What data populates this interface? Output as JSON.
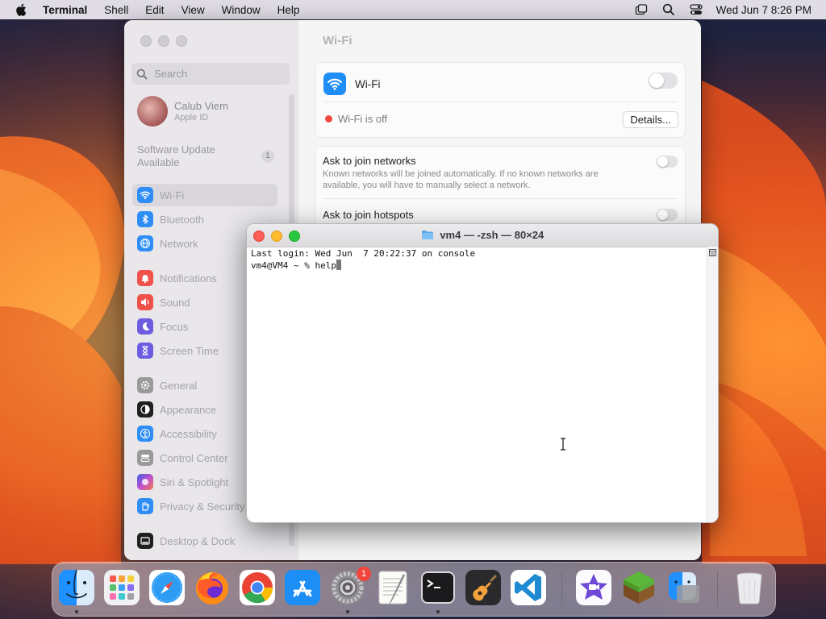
{
  "menubar": {
    "app_name": "Terminal",
    "items": [
      "Shell",
      "Edit",
      "View",
      "Window",
      "Help"
    ],
    "clock": "Wed Jun 7  8:26 PM"
  },
  "settings": {
    "search_placeholder": "Search",
    "account": {
      "name": "Calub Viem",
      "sub": "Apple ID"
    },
    "update": {
      "label_line1": "Software Update",
      "label_line2": "Available",
      "count": "1"
    },
    "sidebar_items": [
      {
        "label": "Wi-Fi",
        "icon": "wifi-icon",
        "color": "#2f8ef6"
      },
      {
        "label": "Bluetooth",
        "icon": "bluetooth-icon",
        "color": "#2f8ef6"
      },
      {
        "label": "Network",
        "icon": "globe-icon",
        "color": "#2f8ef6"
      },
      {
        "label": "Notifications",
        "icon": "bell-icon",
        "color": "#f0524b"
      },
      {
        "label": "Sound",
        "icon": "speaker-icon",
        "color": "#f0524b"
      },
      {
        "label": "Focus",
        "icon": "moon-icon",
        "color": "#6d5ce0"
      },
      {
        "label": "Screen Time",
        "icon": "hourglass-icon",
        "color": "#6d5ce0"
      },
      {
        "label": "General",
        "icon": "gear-icon",
        "color": "#9a989b"
      },
      {
        "label": "Appearance",
        "icon": "appearance-icon",
        "color": "#1f1f1f"
      },
      {
        "label": "Accessibility",
        "icon": "accessibility-icon",
        "color": "#2f8ef6"
      },
      {
        "label": "Control Center",
        "icon": "control-center-icon",
        "color": "#9a989b"
      },
      {
        "label": "Siri & Spotlight",
        "icon": "siri-icon",
        "color": "#c050d0"
      },
      {
        "label": "Privacy & Security",
        "icon": "hand-icon",
        "color": "#2f8ef6"
      },
      {
        "label": "Desktop & Dock",
        "icon": "dock-icon",
        "color": "#1f1f1f"
      }
    ],
    "content": {
      "title": "Wi-Fi",
      "wifi_label": "Wi-Fi",
      "wifi_status": "Wi-Fi is off",
      "details_label": "Details...",
      "ask_networks_title": "Ask to join networks",
      "ask_networks_desc": "Known networks will be joined automatically. If no known networks are available, you will have to manually select a network.",
      "ask_hotspots_title": "Ask to join hotspots"
    }
  },
  "terminal": {
    "title": "vm4 — -zsh — 80×24",
    "line1": "Last login: Wed Jun  7 20:22:37 on console",
    "prompt": "vm4@VM4 ~ % ",
    "command": "help"
  },
  "dock": {
    "apps": [
      {
        "name": "Finder",
        "running": true
      },
      {
        "name": "Launchpad",
        "running": false
      },
      {
        "name": "Safari",
        "running": false
      },
      {
        "name": "Firefox",
        "running": false
      },
      {
        "name": "Chrome",
        "running": false
      },
      {
        "name": "App Store",
        "running": false
      },
      {
        "name": "System Settings",
        "running": true,
        "badge": "1"
      },
      {
        "name": "TextEdit",
        "running": false
      },
      {
        "name": "Terminal",
        "running": true
      },
      {
        "name": "GarageBand",
        "running": false
      },
      {
        "name": "Visual Studio Code",
        "running": false
      },
      {
        "name": "iMovie",
        "running": false
      },
      {
        "name": "Minecraft",
        "running": false
      },
      {
        "name": "Finder Folder",
        "running": false
      },
      {
        "name": "Trash",
        "running": false
      }
    ]
  }
}
